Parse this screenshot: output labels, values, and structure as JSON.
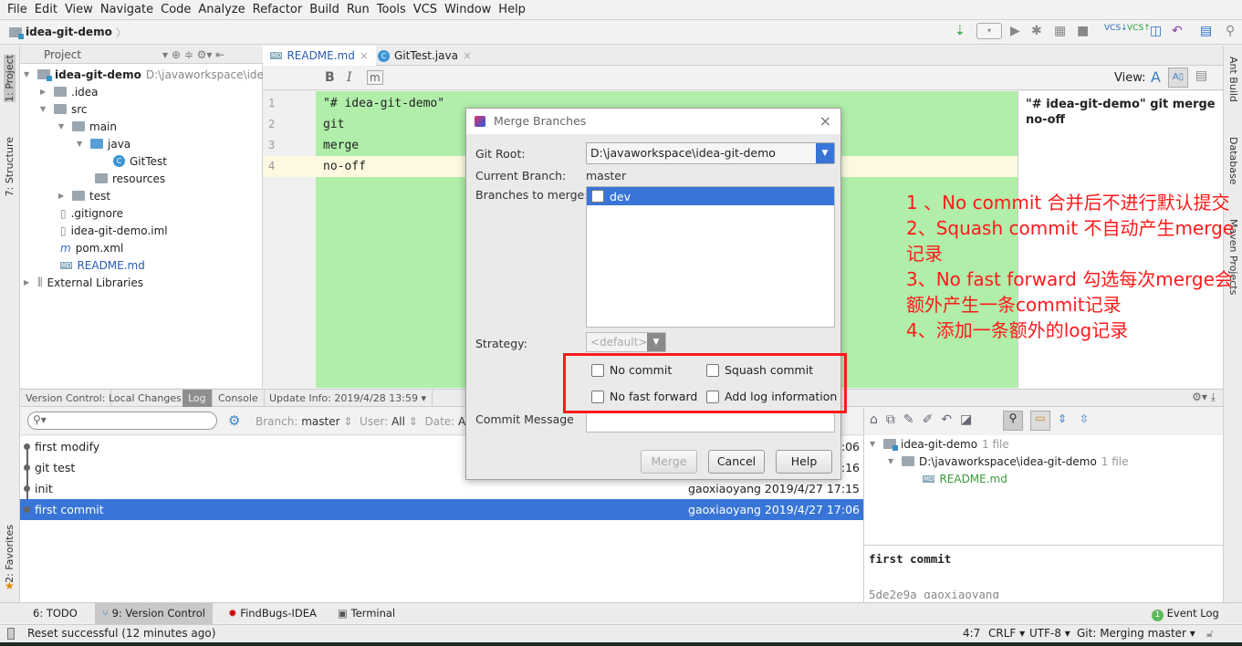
{
  "menu": [
    "File",
    "Edit",
    "View",
    "Navigate",
    "Code",
    "Analyze",
    "Refactor",
    "Build",
    "Run",
    "Tools",
    "VCS",
    "Window",
    "Help"
  ],
  "breadcrumb": "idea-git-demo",
  "project_panel": {
    "title": "Project",
    "root": "idea-git-demo",
    "root_path": "D:\\javaworkspace\\idea",
    "items": [
      ".idea",
      "src",
      "main",
      "java",
      "GitTest",
      "resources",
      "test",
      ".gitignore",
      "idea-git-demo.iml",
      "pom.xml",
      "README.md",
      "External Libraries"
    ]
  },
  "left_strip": [
    "1: Project",
    "7: Structure",
    "2: Favorites"
  ],
  "right_strip": [
    "Ant Build",
    "Database",
    "Maven Projects"
  ],
  "editor": {
    "tabs": [
      "README.md",
      "GitTest.java"
    ],
    "format_buttons": [
      "B",
      "I",
      "m"
    ],
    "view_label": "View:",
    "lines": [
      {
        "n": "1",
        "text": "\"# idea-git-demo\""
      },
      {
        "n": "2",
        "text": "git"
      },
      {
        "n": "3",
        "text": "merge"
      },
      {
        "n": "4",
        "text": "no-off"
      }
    ],
    "preview": "\"# idea-git-demo\" git merge no-off"
  },
  "bottom_tabs": {
    "label": "Version Control:",
    "tabs": [
      "Local Changes",
      "Log",
      "Console",
      "Update Info: 2019/4/28 13:59 ▾"
    ],
    "active": "Log"
  },
  "log_filters": {
    "branch_label": "Branch:",
    "branch": "master",
    "user_label": "User:",
    "user": "All",
    "date_label": "Date:",
    "date": "All"
  },
  "log": [
    {
      "msg": "first modify",
      "author": "",
      "date": ":06"
    },
    {
      "msg": "git test",
      "author": "",
      "date": ":16"
    },
    {
      "msg": "init",
      "author": "gaoxiaoyang",
      "date": "2019/4/27 17:15"
    },
    {
      "msg": "first commit",
      "author": "gaoxiaoyang",
      "date": "2019/4/27 17:06",
      "selected": true
    }
  ],
  "changes": {
    "root": "idea-git-demo",
    "root_count": "1 file",
    "path": "D:\\javaworkspace\\idea-git-demo",
    "path_count": "1 file",
    "file": "README.md"
  },
  "detail": {
    "message": "first commit",
    "hash_line": "5de2e9a gaoxiaoyang"
  },
  "tool_windows": [
    "6: TODO",
    "9: Version Control",
    "FindBugs-IDEA",
    "Terminal"
  ],
  "event_log": "Event Log",
  "event_count": "1",
  "status": {
    "message": "Reset successful (12 minutes ago)",
    "position": "4:7",
    "line_sep": "CRLF ▾",
    "encoding": "UTF-8 ▾",
    "vcs": "Git: Merging master ▾"
  },
  "dialog": {
    "title": "Merge Branches",
    "git_root_label": "Git Root:",
    "git_root": "D:\\javaworkspace\\idea-git-demo",
    "current_branch_label": "Current Branch:",
    "current_branch": "master",
    "branches_label": "Branches to merge:",
    "branches": [
      {
        "name": "dev",
        "checked": false
      }
    ],
    "strategy_label": "Strategy:",
    "strategy": "<default>",
    "options": [
      {
        "label": "No commit",
        "checked": false
      },
      {
        "label": "Squash commit",
        "checked": false
      },
      {
        "label": "No fast forward",
        "checked": false
      },
      {
        "label": "Add log information",
        "checked": false
      }
    ],
    "commit_message_label": "Commit Message",
    "commit_message": "",
    "buttons": {
      "merge": "Merge",
      "cancel": "Cancel",
      "help": "Help"
    }
  },
  "annotations": [
    "1 、No commit 合并后不进行默认提交",
    "2、Squash commit 不自动产生merge记录",
    "3、No fast forward 勾选每次merge会额外产生一条commit记录",
    "4、添加一条额外的log记录"
  ],
  "colors": {
    "selection": "#3875d7",
    "annotation": "#ff1a1a",
    "diff_added": "#b0eeaa"
  }
}
